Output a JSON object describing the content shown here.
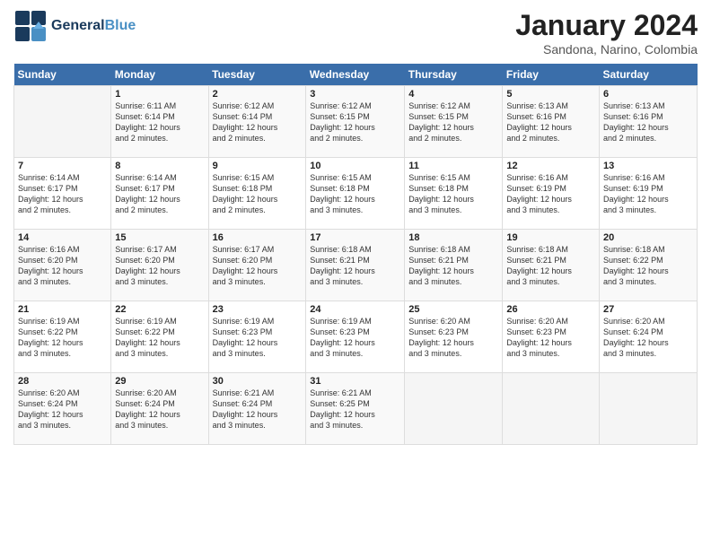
{
  "header": {
    "logo_general": "General",
    "logo_blue": "Blue",
    "month_title": "January 2024",
    "subtitle": "Sandona, Narino, Colombia"
  },
  "days_of_week": [
    "Sunday",
    "Monday",
    "Tuesday",
    "Wednesday",
    "Thursday",
    "Friday",
    "Saturday"
  ],
  "weeks": [
    [
      {
        "day": "",
        "info": ""
      },
      {
        "day": "1",
        "info": "Sunrise: 6:11 AM\nSunset: 6:14 PM\nDaylight: 12 hours\nand 2 minutes."
      },
      {
        "day": "2",
        "info": "Sunrise: 6:12 AM\nSunset: 6:14 PM\nDaylight: 12 hours\nand 2 minutes."
      },
      {
        "day": "3",
        "info": "Sunrise: 6:12 AM\nSunset: 6:15 PM\nDaylight: 12 hours\nand 2 minutes."
      },
      {
        "day": "4",
        "info": "Sunrise: 6:12 AM\nSunset: 6:15 PM\nDaylight: 12 hours\nand 2 minutes."
      },
      {
        "day": "5",
        "info": "Sunrise: 6:13 AM\nSunset: 6:16 PM\nDaylight: 12 hours\nand 2 minutes."
      },
      {
        "day": "6",
        "info": "Sunrise: 6:13 AM\nSunset: 6:16 PM\nDaylight: 12 hours\nand 2 minutes."
      }
    ],
    [
      {
        "day": "7",
        "info": "Sunrise: 6:14 AM\nSunset: 6:17 PM\nDaylight: 12 hours\nand 2 minutes."
      },
      {
        "day": "8",
        "info": "Sunrise: 6:14 AM\nSunset: 6:17 PM\nDaylight: 12 hours\nand 2 minutes."
      },
      {
        "day": "9",
        "info": "Sunrise: 6:15 AM\nSunset: 6:18 PM\nDaylight: 12 hours\nand 2 minutes."
      },
      {
        "day": "10",
        "info": "Sunrise: 6:15 AM\nSunset: 6:18 PM\nDaylight: 12 hours\nand 3 minutes."
      },
      {
        "day": "11",
        "info": "Sunrise: 6:15 AM\nSunset: 6:18 PM\nDaylight: 12 hours\nand 3 minutes."
      },
      {
        "day": "12",
        "info": "Sunrise: 6:16 AM\nSunset: 6:19 PM\nDaylight: 12 hours\nand 3 minutes."
      },
      {
        "day": "13",
        "info": "Sunrise: 6:16 AM\nSunset: 6:19 PM\nDaylight: 12 hours\nand 3 minutes."
      }
    ],
    [
      {
        "day": "14",
        "info": "Sunrise: 6:16 AM\nSunset: 6:20 PM\nDaylight: 12 hours\nand 3 minutes."
      },
      {
        "day": "15",
        "info": "Sunrise: 6:17 AM\nSunset: 6:20 PM\nDaylight: 12 hours\nand 3 minutes."
      },
      {
        "day": "16",
        "info": "Sunrise: 6:17 AM\nSunset: 6:20 PM\nDaylight: 12 hours\nand 3 minutes."
      },
      {
        "day": "17",
        "info": "Sunrise: 6:18 AM\nSunset: 6:21 PM\nDaylight: 12 hours\nand 3 minutes."
      },
      {
        "day": "18",
        "info": "Sunrise: 6:18 AM\nSunset: 6:21 PM\nDaylight: 12 hours\nand 3 minutes."
      },
      {
        "day": "19",
        "info": "Sunrise: 6:18 AM\nSunset: 6:21 PM\nDaylight: 12 hours\nand 3 minutes."
      },
      {
        "day": "20",
        "info": "Sunrise: 6:18 AM\nSunset: 6:22 PM\nDaylight: 12 hours\nand 3 minutes."
      }
    ],
    [
      {
        "day": "21",
        "info": "Sunrise: 6:19 AM\nSunset: 6:22 PM\nDaylight: 12 hours\nand 3 minutes."
      },
      {
        "day": "22",
        "info": "Sunrise: 6:19 AM\nSunset: 6:22 PM\nDaylight: 12 hours\nand 3 minutes."
      },
      {
        "day": "23",
        "info": "Sunrise: 6:19 AM\nSunset: 6:23 PM\nDaylight: 12 hours\nand 3 minutes."
      },
      {
        "day": "24",
        "info": "Sunrise: 6:19 AM\nSunset: 6:23 PM\nDaylight: 12 hours\nand 3 minutes."
      },
      {
        "day": "25",
        "info": "Sunrise: 6:20 AM\nSunset: 6:23 PM\nDaylight: 12 hours\nand 3 minutes."
      },
      {
        "day": "26",
        "info": "Sunrise: 6:20 AM\nSunset: 6:23 PM\nDaylight: 12 hours\nand 3 minutes."
      },
      {
        "day": "27",
        "info": "Sunrise: 6:20 AM\nSunset: 6:24 PM\nDaylight: 12 hours\nand 3 minutes."
      }
    ],
    [
      {
        "day": "28",
        "info": "Sunrise: 6:20 AM\nSunset: 6:24 PM\nDaylight: 12 hours\nand 3 minutes."
      },
      {
        "day": "29",
        "info": "Sunrise: 6:20 AM\nSunset: 6:24 PM\nDaylight: 12 hours\nand 3 minutes."
      },
      {
        "day": "30",
        "info": "Sunrise: 6:21 AM\nSunset: 6:24 PM\nDaylight: 12 hours\nand 3 minutes."
      },
      {
        "day": "31",
        "info": "Sunrise: 6:21 AM\nSunset: 6:25 PM\nDaylight: 12 hours\nand 3 minutes."
      },
      {
        "day": "",
        "info": ""
      },
      {
        "day": "",
        "info": ""
      },
      {
        "day": "",
        "info": ""
      }
    ]
  ]
}
